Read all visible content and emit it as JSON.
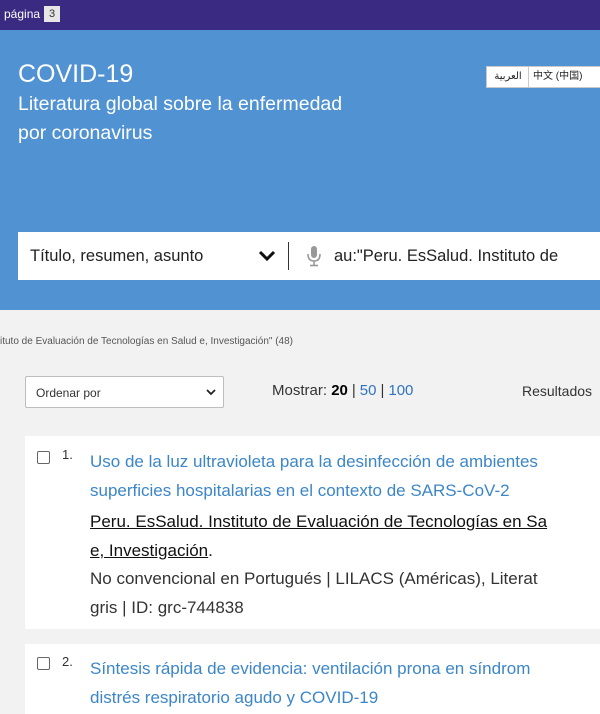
{
  "topbar": {
    "label": "página",
    "page_number": "3"
  },
  "header": {
    "title": "COVID-19",
    "subtitle_line1": "Literatura global sobre la enfermedad",
    "subtitle_line2": "por coronavirus",
    "languages": [
      "العربية",
      "中文 (中国)"
    ]
  },
  "search": {
    "field_label": "Título, resumen, asunto",
    "query": "au:\"Peru. EsSalud. Instituto de"
  },
  "breadcrumb": "ituto de Evaluación de Tecnologías en Salud e, Investigación\" (48)",
  "controls": {
    "sort_label": "Ordenar por",
    "show_label": "Mostrar:",
    "show_options": [
      "20",
      "50",
      "100"
    ],
    "results_label": "Resultados"
  },
  "results": [
    {
      "number": "1.",
      "title_line1": "Uso de la luz ultravioleta para la desinfección de ambientes",
      "title_line2": "superficies hospitalarias en el contexto de SARS-CoV-2",
      "author_line1": "Peru. EsSalud. Instituto de Evaluación de Tecnologías en Sa",
      "author_line2": "e, Investigación",
      "meta_line1": "No convencional en Portugués | LILACS (Américas), Literat",
      "meta_line2": "gris | ID: grc-744838"
    },
    {
      "number": "2.",
      "title_line1": "Síntesis rápida de evidencia: ventilación prona en síndrom",
      "title_line2": "distrés respiratorio agudo y COVID-19"
    }
  ]
}
